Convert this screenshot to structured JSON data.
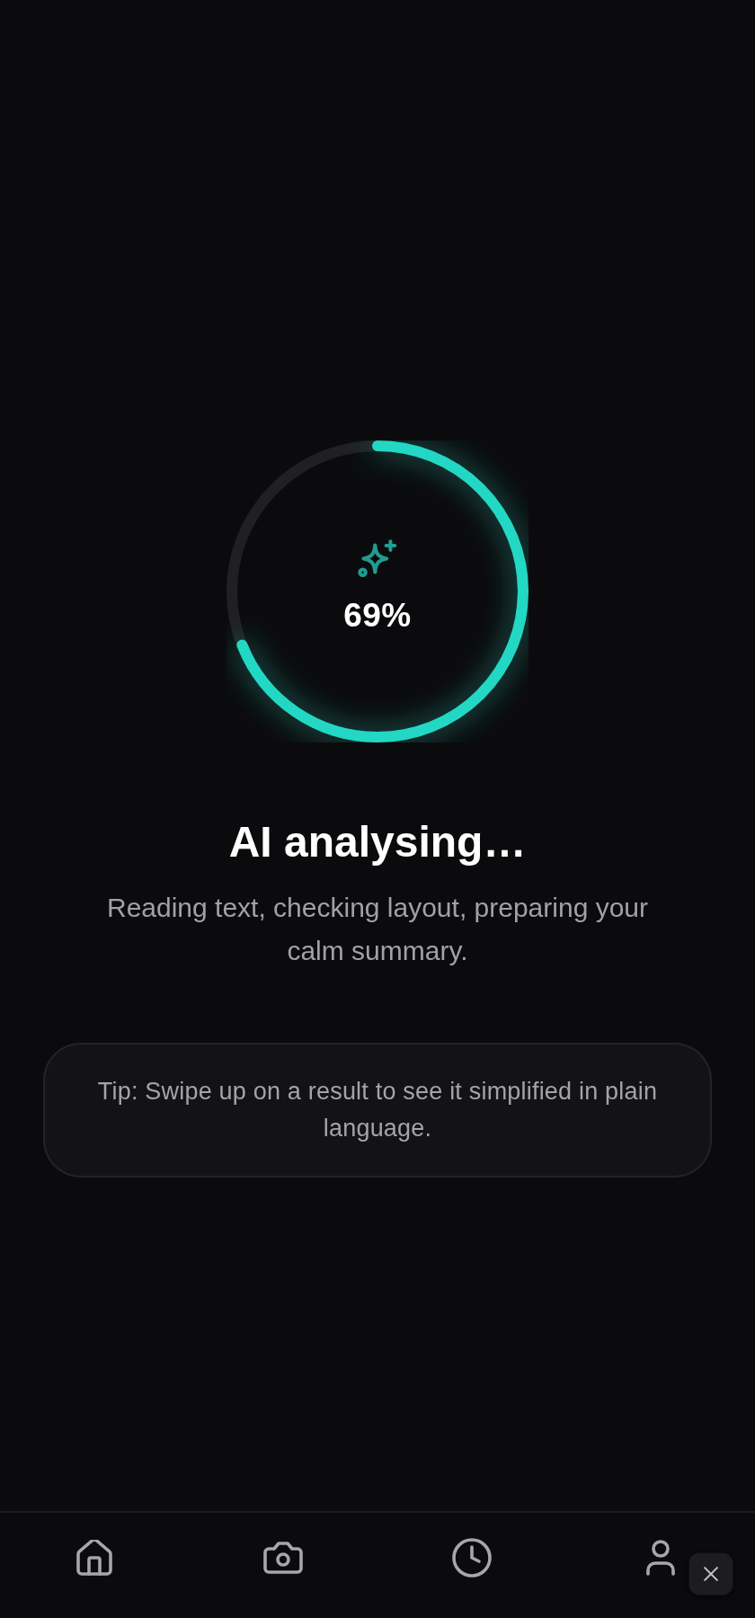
{
  "progress": {
    "level": 0.69,
    "reading": "69%"
  },
  "title": "AI analysing…",
  "subtitle": "Reading text, checking layout, preparing your calm summary.",
  "tip": "Tip: Swipe up on a result to see it simplified in plain language.",
  "bottom_nav": [
    {
      "kind": "home",
      "selected": false
    },
    {
      "kind": "camera",
      "selected": false
    },
    {
      "kind": "clock",
      "selected": false
    },
    {
      "kind": "profile",
      "selected": false
    }
  ]
}
